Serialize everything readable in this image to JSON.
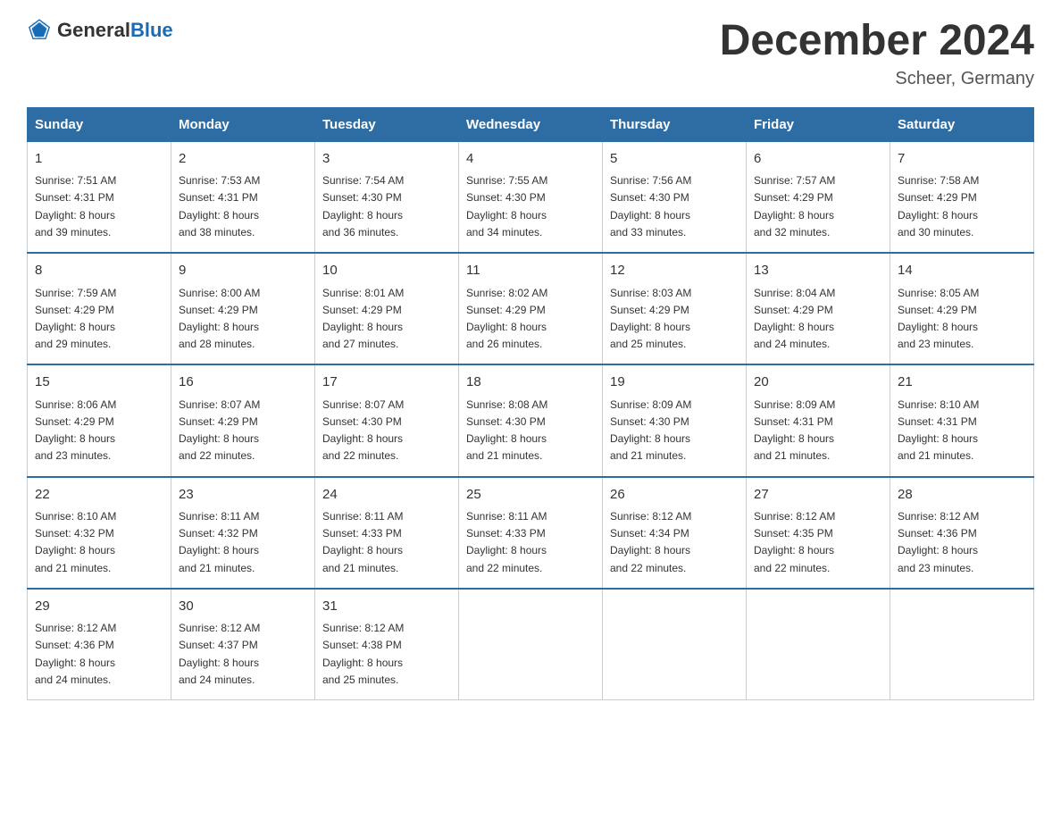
{
  "logo": {
    "text_general": "General",
    "text_blue": "Blue"
  },
  "title": "December 2024",
  "subtitle": "Scheer, Germany",
  "days_of_week": [
    "Sunday",
    "Monday",
    "Tuesday",
    "Wednesday",
    "Thursday",
    "Friday",
    "Saturday"
  ],
  "weeks": [
    [
      {
        "day": "1",
        "sunrise": "7:51 AM",
        "sunset": "4:31 PM",
        "daylight": "8 hours and 39 minutes."
      },
      {
        "day": "2",
        "sunrise": "7:53 AM",
        "sunset": "4:31 PM",
        "daylight": "8 hours and 38 minutes."
      },
      {
        "day": "3",
        "sunrise": "7:54 AM",
        "sunset": "4:30 PM",
        "daylight": "8 hours and 36 minutes."
      },
      {
        "day": "4",
        "sunrise": "7:55 AM",
        "sunset": "4:30 PM",
        "daylight": "8 hours and 34 minutes."
      },
      {
        "day": "5",
        "sunrise": "7:56 AM",
        "sunset": "4:30 PM",
        "daylight": "8 hours and 33 minutes."
      },
      {
        "day": "6",
        "sunrise": "7:57 AM",
        "sunset": "4:29 PM",
        "daylight": "8 hours and 32 minutes."
      },
      {
        "day": "7",
        "sunrise": "7:58 AM",
        "sunset": "4:29 PM",
        "daylight": "8 hours and 30 minutes."
      }
    ],
    [
      {
        "day": "8",
        "sunrise": "7:59 AM",
        "sunset": "4:29 PM",
        "daylight": "8 hours and 29 minutes."
      },
      {
        "day": "9",
        "sunrise": "8:00 AM",
        "sunset": "4:29 PM",
        "daylight": "8 hours and 28 minutes."
      },
      {
        "day": "10",
        "sunrise": "8:01 AM",
        "sunset": "4:29 PM",
        "daylight": "8 hours and 27 minutes."
      },
      {
        "day": "11",
        "sunrise": "8:02 AM",
        "sunset": "4:29 PM",
        "daylight": "8 hours and 26 minutes."
      },
      {
        "day": "12",
        "sunrise": "8:03 AM",
        "sunset": "4:29 PM",
        "daylight": "8 hours and 25 minutes."
      },
      {
        "day": "13",
        "sunrise": "8:04 AM",
        "sunset": "4:29 PM",
        "daylight": "8 hours and 24 minutes."
      },
      {
        "day": "14",
        "sunrise": "8:05 AM",
        "sunset": "4:29 PM",
        "daylight": "8 hours and 23 minutes."
      }
    ],
    [
      {
        "day": "15",
        "sunrise": "8:06 AM",
        "sunset": "4:29 PM",
        "daylight": "8 hours and 23 minutes."
      },
      {
        "day": "16",
        "sunrise": "8:07 AM",
        "sunset": "4:29 PM",
        "daylight": "8 hours and 22 minutes."
      },
      {
        "day": "17",
        "sunrise": "8:07 AM",
        "sunset": "4:30 PM",
        "daylight": "8 hours and 22 minutes."
      },
      {
        "day": "18",
        "sunrise": "8:08 AM",
        "sunset": "4:30 PM",
        "daylight": "8 hours and 21 minutes."
      },
      {
        "day": "19",
        "sunrise": "8:09 AM",
        "sunset": "4:30 PM",
        "daylight": "8 hours and 21 minutes."
      },
      {
        "day": "20",
        "sunrise": "8:09 AM",
        "sunset": "4:31 PM",
        "daylight": "8 hours and 21 minutes."
      },
      {
        "day": "21",
        "sunrise": "8:10 AM",
        "sunset": "4:31 PM",
        "daylight": "8 hours and 21 minutes."
      }
    ],
    [
      {
        "day": "22",
        "sunrise": "8:10 AM",
        "sunset": "4:32 PM",
        "daylight": "8 hours and 21 minutes."
      },
      {
        "day": "23",
        "sunrise": "8:11 AM",
        "sunset": "4:32 PM",
        "daylight": "8 hours and 21 minutes."
      },
      {
        "day": "24",
        "sunrise": "8:11 AM",
        "sunset": "4:33 PM",
        "daylight": "8 hours and 21 minutes."
      },
      {
        "day": "25",
        "sunrise": "8:11 AM",
        "sunset": "4:33 PM",
        "daylight": "8 hours and 22 minutes."
      },
      {
        "day": "26",
        "sunrise": "8:12 AM",
        "sunset": "4:34 PM",
        "daylight": "8 hours and 22 minutes."
      },
      {
        "day": "27",
        "sunrise": "8:12 AM",
        "sunset": "4:35 PM",
        "daylight": "8 hours and 22 minutes."
      },
      {
        "day": "28",
        "sunrise": "8:12 AM",
        "sunset": "4:36 PM",
        "daylight": "8 hours and 23 minutes."
      }
    ],
    [
      {
        "day": "29",
        "sunrise": "8:12 AM",
        "sunset": "4:36 PM",
        "daylight": "8 hours and 24 minutes."
      },
      {
        "day": "30",
        "sunrise": "8:12 AM",
        "sunset": "4:37 PM",
        "daylight": "8 hours and 24 minutes."
      },
      {
        "day": "31",
        "sunrise": "8:12 AM",
        "sunset": "4:38 PM",
        "daylight": "8 hours and 25 minutes."
      },
      null,
      null,
      null,
      null
    ]
  ]
}
